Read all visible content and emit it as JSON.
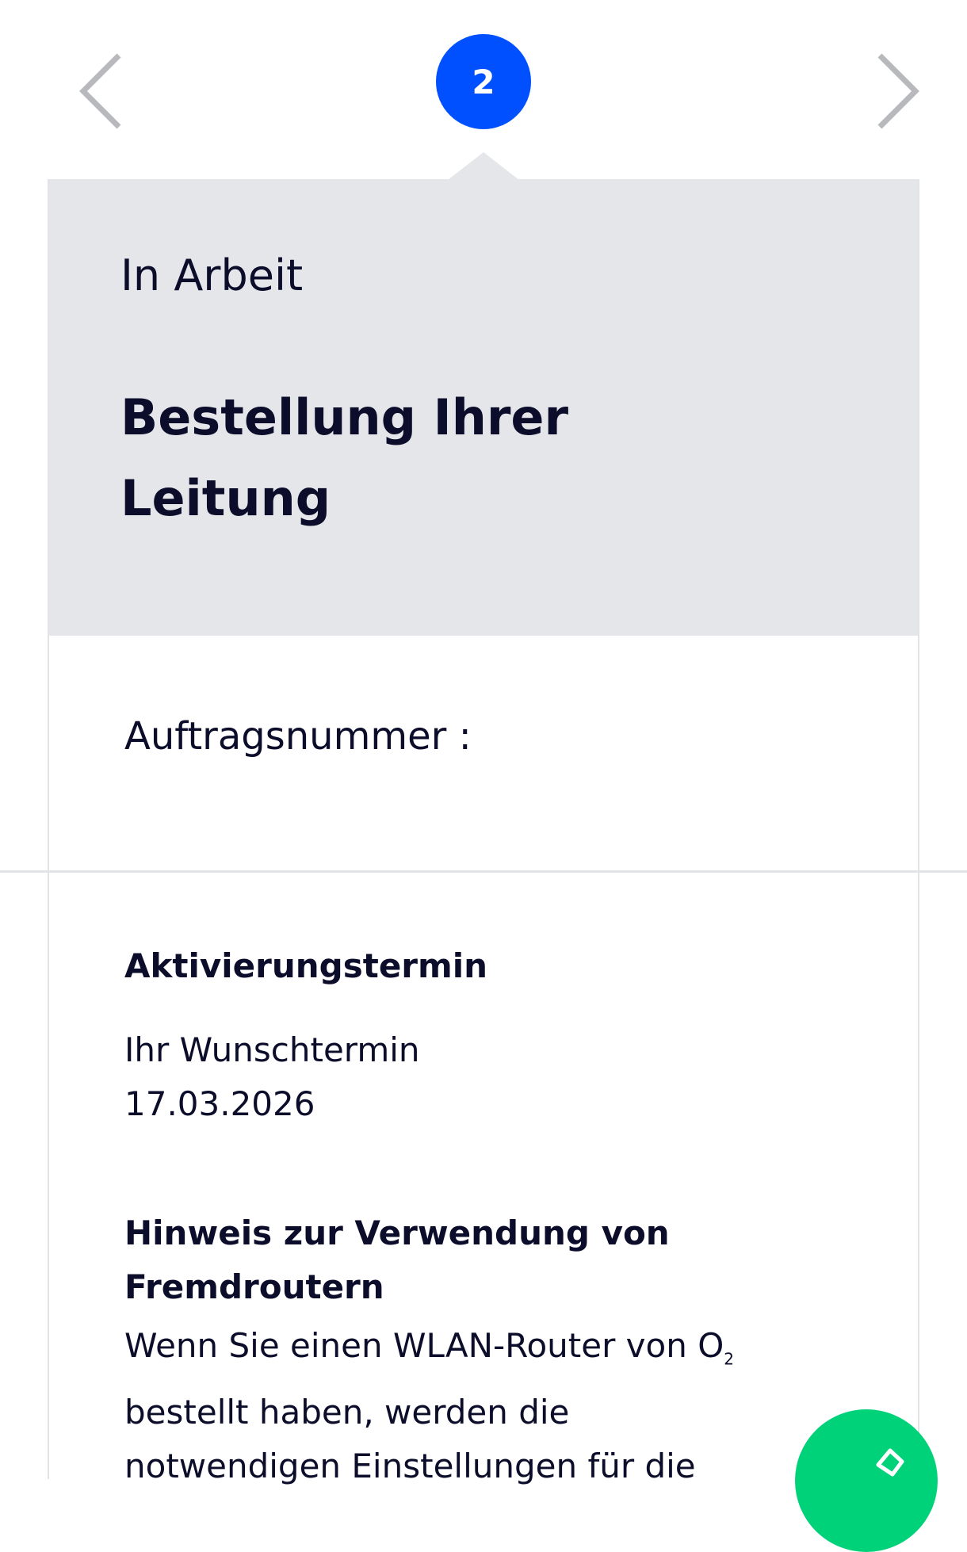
{
  "stepper": {
    "current_step": "2"
  },
  "card": {
    "status": "In Arbeit",
    "title": "Bestellung Ihrer Leitung",
    "order_number_label": "Auftragsnummer :"
  },
  "activation": {
    "title": "Aktivierungstermin",
    "label": "Ihr Wunschtermin",
    "date": "17.03.2026"
  },
  "router_notice": {
    "title": "Hinweis zur Verwendung von Fremdroutern",
    "text_start": "Wenn Sie einen WLAN-Router von O",
    "brand_subscript": "2",
    "text_rest": "bestellt haben, werden die notwendigen Einstellungen für die"
  },
  "colors": {
    "accent": "#0050ff",
    "card_header_bg": "#e5e6ea",
    "fab": "#00d27a",
    "text": "#0b0d2a"
  },
  "icons": {
    "prev": "chevron-left-icon",
    "next": "chevron-right-icon",
    "fab": "chat-icon"
  }
}
